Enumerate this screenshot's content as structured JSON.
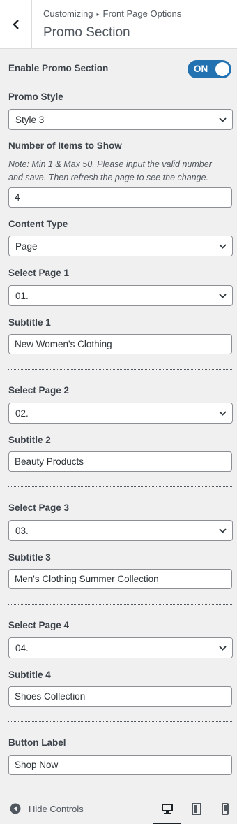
{
  "header": {
    "breadcrumb_root": "Customizing",
    "breadcrumb_separator": "▸",
    "breadcrumb_parent": "Front Page Options",
    "title": "Promo Section"
  },
  "enable": {
    "label": "Enable Promo Section",
    "toggle_text": "ON",
    "state": "on",
    "accent": "#2271b1"
  },
  "promo_style": {
    "label": "Promo Style",
    "value": "Style 3"
  },
  "items": {
    "label": "Number of Items to Show",
    "note_line1": "Note: Min 1 & Max 50. Please input the valid number",
    "note_line2": "and save. Then refresh the page to see the change.",
    "value": "4"
  },
  "content_type": {
    "label": "Content Type",
    "value": "Page"
  },
  "pages": [
    {
      "select_label": "Select Page 1",
      "select_value": "01.",
      "subtitle_label": "Subtitle 1",
      "subtitle_value": "New Women's Clothing"
    },
    {
      "select_label": "Select Page 2",
      "select_value": "02.",
      "subtitle_label": "Subtitle 2",
      "subtitle_value": "Beauty Products"
    },
    {
      "select_label": "Select Page 3",
      "select_value": "03.",
      "subtitle_label": "Subtitle 3",
      "subtitle_value": "Men's Clothing Summer Collection"
    },
    {
      "select_label": "Select Page 4",
      "select_value": "04.",
      "subtitle_label": "Subtitle 4",
      "subtitle_value": "Shoes Collection"
    }
  ],
  "button_label": {
    "label": "Button Label",
    "value": "Shop Now"
  },
  "footer": {
    "hide_controls": "Hide Controls",
    "devices": [
      "desktop-icon",
      "tablet-icon",
      "mobile-icon"
    ],
    "active_device": "desktop"
  }
}
